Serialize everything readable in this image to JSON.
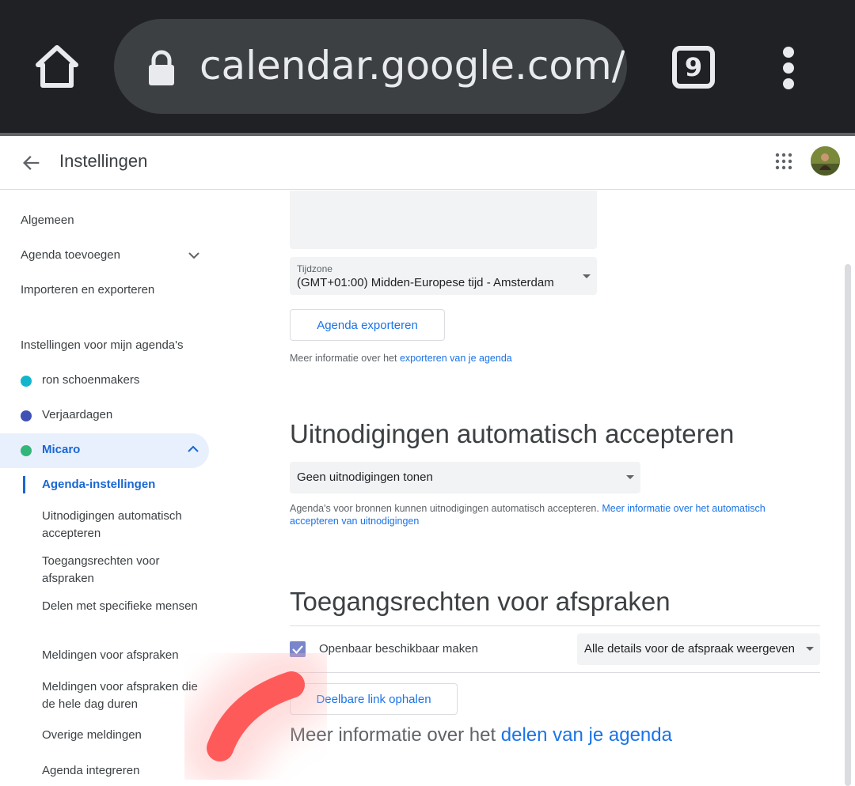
{
  "browser": {
    "url_text": "calendar.google.com/ca",
    "tab_count": "9"
  },
  "header": {
    "title": "Instellingen"
  },
  "sidebar": {
    "items": [
      "Algemeen",
      "Agenda toevoegen",
      "Importeren en exporteren"
    ],
    "section_heading": "Instellingen voor mijn agenda's",
    "calendars": [
      {
        "label": "ron schoenmakers",
        "color": "#12b5cb"
      },
      {
        "label": "Verjaardagen",
        "color": "#3f51b5"
      },
      {
        "label": "Micaro",
        "color": "#33b679"
      }
    ],
    "sub_items": [
      "Agenda-instellingen",
      "Uitnodigingen automatisch accepteren",
      "Toegangsrechten voor afspraken",
      "Delen met specifieke mensen",
      "Meldingen voor afspraken",
      "Meldingen voor afspraken die de hele dag duren",
      "Overige meldingen",
      "Agenda integreren"
    ]
  },
  "main": {
    "timezone": {
      "label": "Tijdzone",
      "value": "(GMT+01:00) Midden-Europese tijd - Amsterdam"
    },
    "export_button": "Agenda exporteren",
    "export_info": {
      "text": "Meer informatie over het ",
      "link": "exporteren van je agenda"
    },
    "auto_accept": {
      "title": "Uitnodigingen automatisch accepteren",
      "select_value": "Geen uitnodigingen tonen",
      "info_text": "Agenda's voor bronnen kunnen uitnodigingen automatisch accepteren. ",
      "info_link": "Meer informatie over het automatisch accepteren van uitnodigingen"
    },
    "access": {
      "title": "Toegangsrechten voor afspraken",
      "checkbox_label": "Openbaar beschikbaar maken",
      "checkbox_checked": true,
      "detail_select": "Alle details voor de afspraak weergeven",
      "share_button": "Deelbare link ophalen",
      "info_text": "Meer informatie over het ",
      "info_link": "delen van je agenda"
    }
  },
  "colors": {
    "accent": "#1a73e8",
    "chrome_bg": "#202124",
    "annotation": "#ff5a5a"
  }
}
